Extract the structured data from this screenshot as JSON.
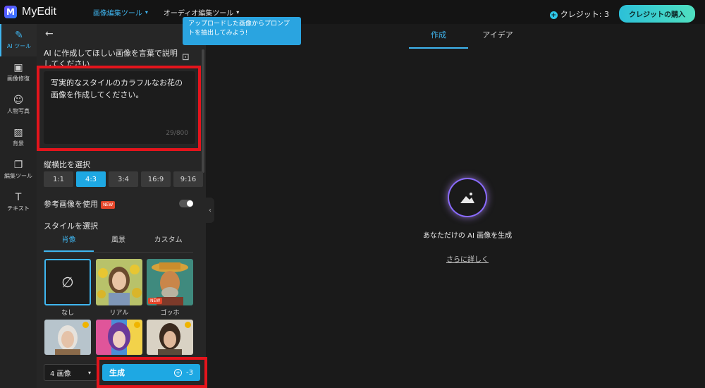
{
  "app": {
    "name": "MyEdit",
    "logo_letter": "M"
  },
  "topnav": {
    "items": [
      {
        "label": "画像編集ツール",
        "active": true
      },
      {
        "label": "オーディオ編集ツール",
        "active": false
      }
    ]
  },
  "credit": {
    "label": "クレジット: 3",
    "buy_label": "クレジットの購入"
  },
  "sidebar": {
    "items": [
      {
        "label": "AI ツール",
        "icon": "magic-wand-icon",
        "active": true
      },
      {
        "label": "画像修復",
        "icon": "image-repair-icon",
        "active": false
      },
      {
        "label": "人物写真",
        "icon": "portrait-icon",
        "active": false
      },
      {
        "label": "背景",
        "icon": "background-icon",
        "active": false
      },
      {
        "label": "編集ツール",
        "icon": "edit-tools-icon",
        "active": false
      },
      {
        "label": "テキスト",
        "icon": "text-icon",
        "active": false
      }
    ]
  },
  "tooltip": "アップロードした画像からプロンプトを抽出してみよう!",
  "prompt": {
    "label": "AI に作成してほしい画像を言葉で説明してください",
    "value": "写実的なスタイルのカラフルなお花の画像を作成してください。",
    "count": "29/800"
  },
  "aspect": {
    "label": "縦横比を選択",
    "options": [
      "1:1",
      "4:3",
      "3:4",
      "16:9",
      "9:16"
    ],
    "selected": "4:3"
  },
  "reference": {
    "label": "参考画像を使用",
    "badge": "NEW",
    "enabled": false
  },
  "style": {
    "label": "スタイルを選択",
    "tabs": [
      "肖像",
      "風景",
      "カスタム"
    ],
    "active_tab": "肖像",
    "items": [
      {
        "label": "なし",
        "selected": true
      },
      {
        "label": "リアル",
        "selected": false
      },
      {
        "label": "ゴッホ",
        "selected": false,
        "badge": "NEW"
      },
      {
        "label": "",
        "premium": true
      },
      {
        "label": "",
        "premium": true
      },
      {
        "label": "",
        "premium": true
      }
    ]
  },
  "footer": {
    "count_label": "4 画像",
    "generate_label": "生成",
    "cost": "-3"
  },
  "main": {
    "tabs": [
      "作成",
      "アイデア"
    ],
    "active_tab": "作成",
    "empty_text": "あなただけの AI 画像を生成",
    "learn_more": "さらに詳しく"
  },
  "colors": {
    "accent": "#3fb6f0",
    "highlight_border": "#e4141c",
    "new_badge": "#e5462a"
  }
}
